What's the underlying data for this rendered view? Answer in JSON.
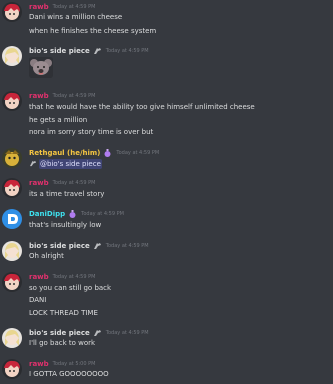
{
  "colors": {
    "background": "#36393f",
    "rawb": "#e0316d",
    "rethgaul": "#f4c542",
    "danidipp": "#3ee0ee",
    "bio": "#dcddde",
    "timestamp": "#72767d",
    "mention_bg": "#4f5293"
  },
  "messages": [
    {
      "author": "rawb",
      "time": "Today at 4:59 PM",
      "lines": [
        "Dani wins a million cheese",
        "when he finishes the cheese system"
      ]
    },
    {
      "author": "bio's side piece",
      "badge_icon": "tilted-figure-icon",
      "time": "Today at 4:59 PM",
      "attachment": "koala-face-image"
    },
    {
      "author": "rawb",
      "time": "Today at 4:59 PM",
      "lines": [
        "that he would have the ability too give himself unlimited cheese",
        "he gets a million",
        "nora im sorry story time is over but"
      ]
    },
    {
      "author": "Rethgaul (he/him)",
      "badge_icon": "potion-icon",
      "time": "Today at 4:59 PM",
      "mention": "@bio's side piece"
    },
    {
      "author": "rawb",
      "time": "Today at 4:59 PM",
      "lines": [
        "its a time travel story"
      ]
    },
    {
      "author": "DaniDipp",
      "badge_icon": "potion-icon",
      "time": "Today at 4:59 PM",
      "lines": [
        "that's insultingly low"
      ]
    },
    {
      "author": "bio's side piece",
      "badge_icon": "tilted-figure-icon",
      "time": "Today at 4:59 PM",
      "lines": [
        "Oh alright"
      ]
    },
    {
      "author": "rawb",
      "time": "Today at 4:59 PM",
      "lines": [
        "so you can still go back",
        "DANI",
        "LOCK THREAD TIME"
      ]
    },
    {
      "author": "bio's side piece",
      "badge_icon": "tilted-figure-icon",
      "time": "Today at 4:59 PM",
      "lines": [
        "I'll go back to work"
      ]
    },
    {
      "author": "rawb",
      "time": "Today at 5:00 PM",
      "lines": [
        "I GOTTA GOOOOOOOO"
      ]
    }
  ]
}
